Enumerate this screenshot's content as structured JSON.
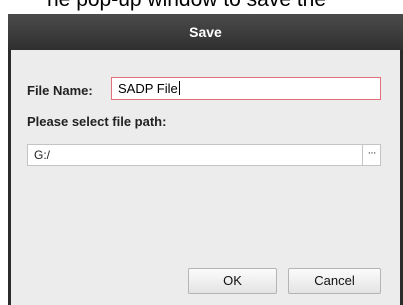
{
  "caption": {
    "text": "ne pop-up window to save the"
  },
  "dialog": {
    "title": "Save",
    "file_name_label": "File Name:",
    "file_name_value": "SADP File",
    "path_label": "Please select file path:",
    "path_value": "G:/",
    "browse_label": "···",
    "ok_label": "OK",
    "cancel_label": "Cancel"
  },
  "colors": {
    "titlebar": "#2f2f2f",
    "body": "#ececec",
    "focused_border": "#e0707a"
  }
}
